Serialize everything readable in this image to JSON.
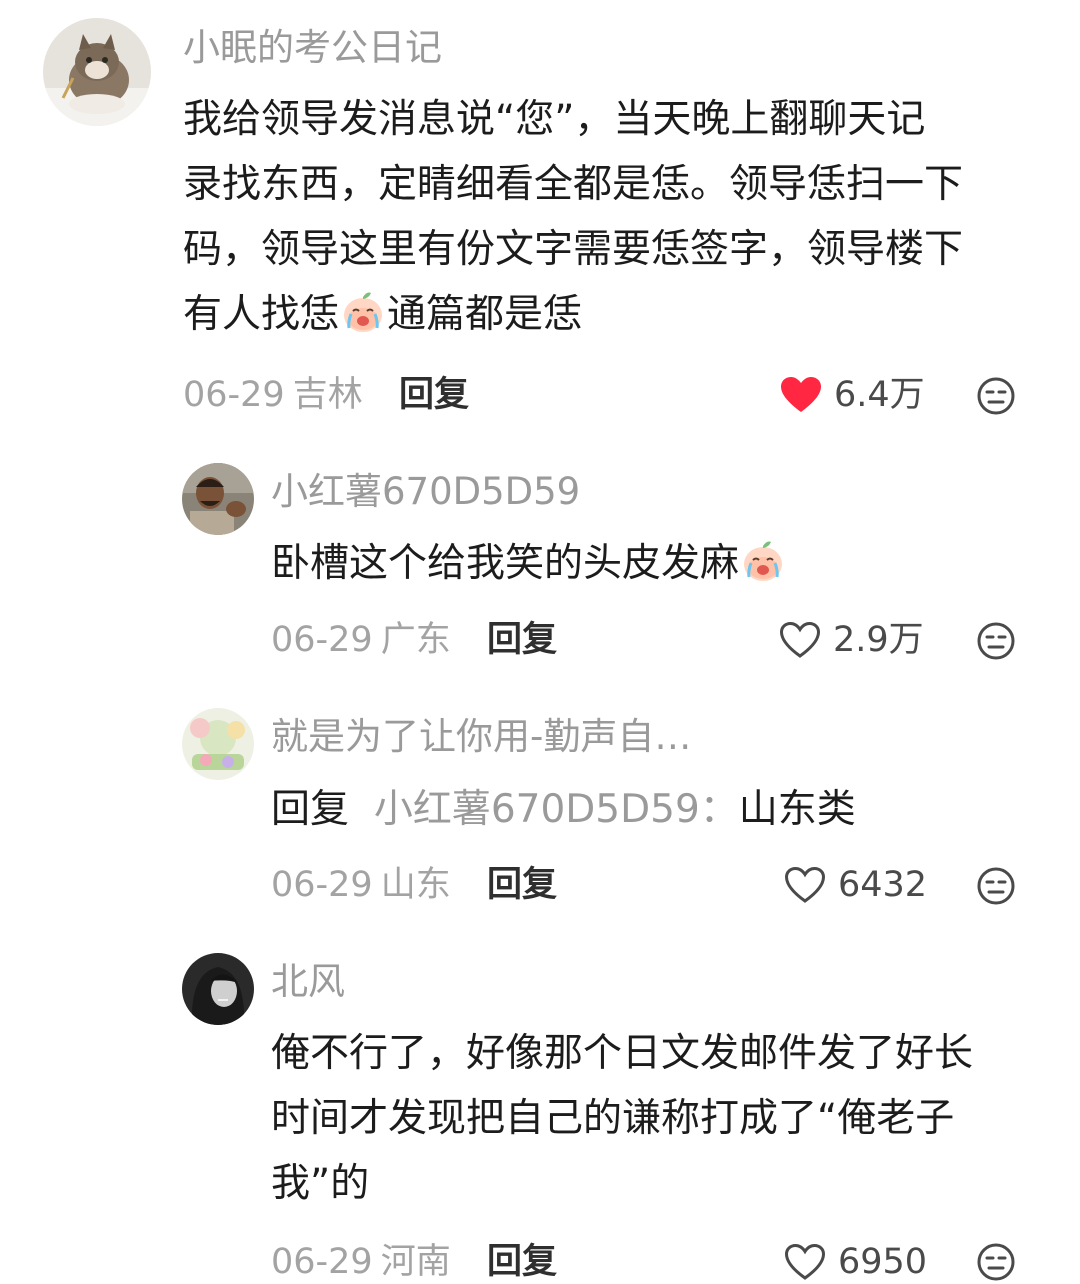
{
  "comments": [
    {
      "user": "小眠的考公日记",
      "avatar": "cat-avatar",
      "lines": [
        "我给领导发消息说“您”，当天晚上翻聊天记",
        "录找东西，定睛细看全都是恁。领导恁扫一下",
        "码，领导这里有份文字需要恁签字，领导楼下"
      ],
      "line4_before": "有人找恁",
      "line4_after": "通篇都是恁",
      "date": "06-29",
      "location": "吉林",
      "reply_label": "回复",
      "likes": "6.4万",
      "liked": true
    },
    {
      "user": "小红薯670D5D59",
      "avatar": "man-avatar",
      "text": "卧槽这个给我笑的头皮发麻",
      "date": "06-29",
      "location": "广东",
      "reply_label": "回复",
      "likes": "2.9万",
      "liked": false
    },
    {
      "user": "就是为了让你用-勤声自…",
      "avatar": "garden-avatar",
      "reply_prefix": "回复",
      "reply_target": "小红薯670D5D59：",
      "text": "山东类",
      "date": "06-29",
      "location": "山东",
      "reply_label": "回复",
      "likes": "6432",
      "liked": false
    },
    {
      "user": "北风",
      "avatar": "woman-avatar",
      "lines": [
        "俺不行了，好像那个日文发邮件发了好长",
        "时间才发现把自己的谦称打成了“俺老子",
        "我”的"
      ],
      "date": "06-29",
      "location": "河南",
      "reply_label": "回复",
      "likes": "6950",
      "liked": false
    }
  ],
  "colors": {
    "like_red": "#ff2741",
    "text": "#1c1c1c",
    "muted": "#9a9a9a"
  },
  "icons": {
    "like": "heart-icon",
    "dislike": "dislike-face-icon",
    "emoji": "crying-peach-emoji"
  }
}
